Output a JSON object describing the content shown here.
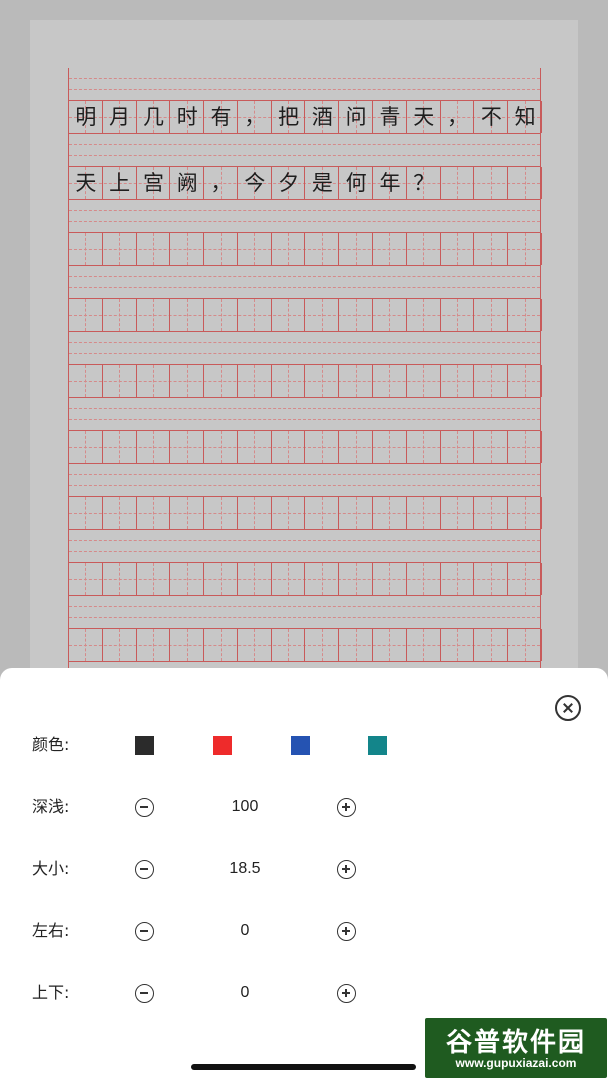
{
  "poem_lines": [
    [
      "明",
      "月",
      "几",
      "时",
      "有",
      "，",
      "把",
      "酒",
      "问",
      "青",
      "天",
      "，",
      "不",
      "知"
    ],
    [
      "天",
      "上",
      "宫",
      "阙",
      "，",
      "今",
      "夕",
      "是",
      "何",
      "年",
      "？",
      "",
      "",
      ""
    ]
  ],
  "settings": {
    "color_label": "颜色:",
    "colors": [
      {
        "name": "black",
        "hex": "#2b2b2b"
      },
      {
        "name": "red",
        "hex": "#ee2b2b"
      },
      {
        "name": "blue",
        "hex": "#2553b2"
      },
      {
        "name": "teal",
        "hex": "#13858a"
      }
    ],
    "depth": {
      "label": "深浅:",
      "value": "100"
    },
    "size": {
      "label": "大小:",
      "value": "18.5"
    },
    "horizontal": {
      "label": "左右:",
      "value": "0"
    },
    "vertical": {
      "label": "上下:",
      "value": "0"
    }
  },
  "watermark": {
    "title": "谷普软件园",
    "url": "www.gupuxiazai.com"
  },
  "icons": {
    "close": "close-circle-icon",
    "minus": "minus-circle-icon",
    "plus": "plus-circle-icon"
  }
}
